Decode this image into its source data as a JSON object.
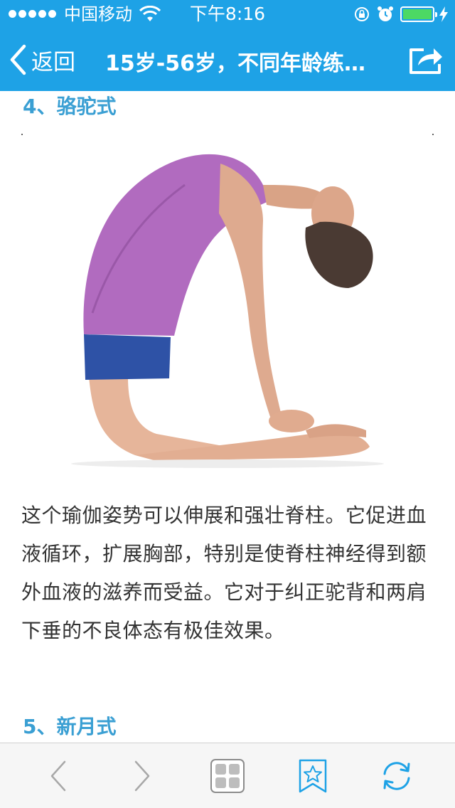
{
  "status_bar": {
    "carrier": "中国移动",
    "time": "下午8:16"
  },
  "nav": {
    "back_label": "返回",
    "title": "15岁-56岁，不同年龄练…"
  },
  "article": {
    "heading_1": "4、骆驼式",
    "photo_icon": "yoga-camel-pose-photo",
    "paragraph": "这个瑜伽姿势可以伸展和强壮脊柱。它促进血液循环，扩展胸部，特别是使脊柱神经得到额外血液的滋养而受益。它对于纠正驼背和两肩下垂的不良体态有极佳效果。",
    "heading_2": "5、新月式"
  },
  "toolbar": {
    "items": [
      "back-icon",
      "forward-icon",
      "tabs-icon",
      "favorites-icon",
      "refresh-icon"
    ]
  },
  "colors": {
    "accent": "#1ea2e6",
    "heading": "#3a9fd3",
    "battery": "#4cd964"
  }
}
